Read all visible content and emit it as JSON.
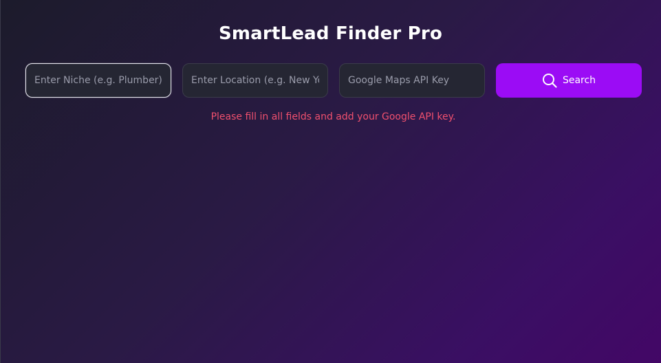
{
  "app": {
    "title": "SmartLead Finder Pro"
  },
  "form": {
    "niche_placeholder": "Enter Niche (e.g. Plumber)",
    "niche_value": "",
    "location_placeholder": "Enter Location (e.g. New York)",
    "location_value": "",
    "api_key_placeholder": "Google Maps API Key",
    "api_key_value": "",
    "search_label": "Search",
    "search_icon": "search-icon"
  },
  "status": {
    "error": "Please fill in all fields and add your Google API key."
  },
  "colors": {
    "accent": "#9b0cf5",
    "error": "#f0506e",
    "input_bg": "#252633"
  }
}
